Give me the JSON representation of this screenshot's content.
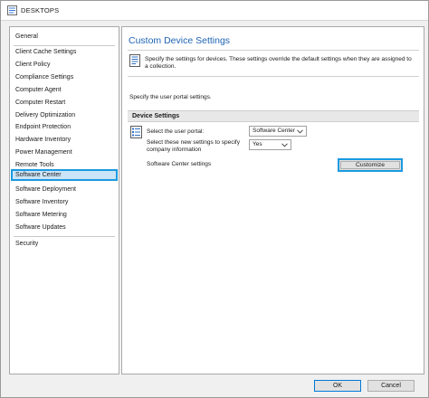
{
  "window": {
    "title": "DESKTOPS"
  },
  "sidebar": {
    "items": [
      {
        "label": "General"
      },
      {
        "label": "Client Cache Settings"
      },
      {
        "label": "Client Policy"
      },
      {
        "label": "Compliance Settings"
      },
      {
        "label": "Computer Agent"
      },
      {
        "label": "Computer Restart"
      },
      {
        "label": "Delivery Optimization"
      },
      {
        "label": "Endpoint Protection"
      },
      {
        "label": "Hardware Inventory"
      },
      {
        "label": "Power Management"
      },
      {
        "label": "Remote Tools"
      },
      {
        "label": "Software Center"
      },
      {
        "label": "Software Deployment"
      },
      {
        "label": "Software Inventory"
      },
      {
        "label": "Software Metering"
      },
      {
        "label": "Software Updates"
      },
      {
        "label": "Security"
      }
    ],
    "selected": "Software Center"
  },
  "content": {
    "title": "Custom Device Settings",
    "description": "Specify the settings for devices. These settings override the default settings when they are assigned to a collection.",
    "portal_note": "Specify the user portal settings.",
    "group_title": "Device Settings",
    "portal_label": "Select the user portal:",
    "portal_value": "Software Center",
    "company_label": "Select these new settings to specify company information",
    "company_value": "Yes",
    "sc_settings_label": "Software Center settings",
    "customize_label": "Customize"
  },
  "footer": {
    "ok_label": "OK",
    "cancel_label": "Cancel"
  },
  "colors": {
    "accent": "#1a9ae0",
    "title_blue": "#1e64b4",
    "selected_bg": "#cce4f7"
  }
}
